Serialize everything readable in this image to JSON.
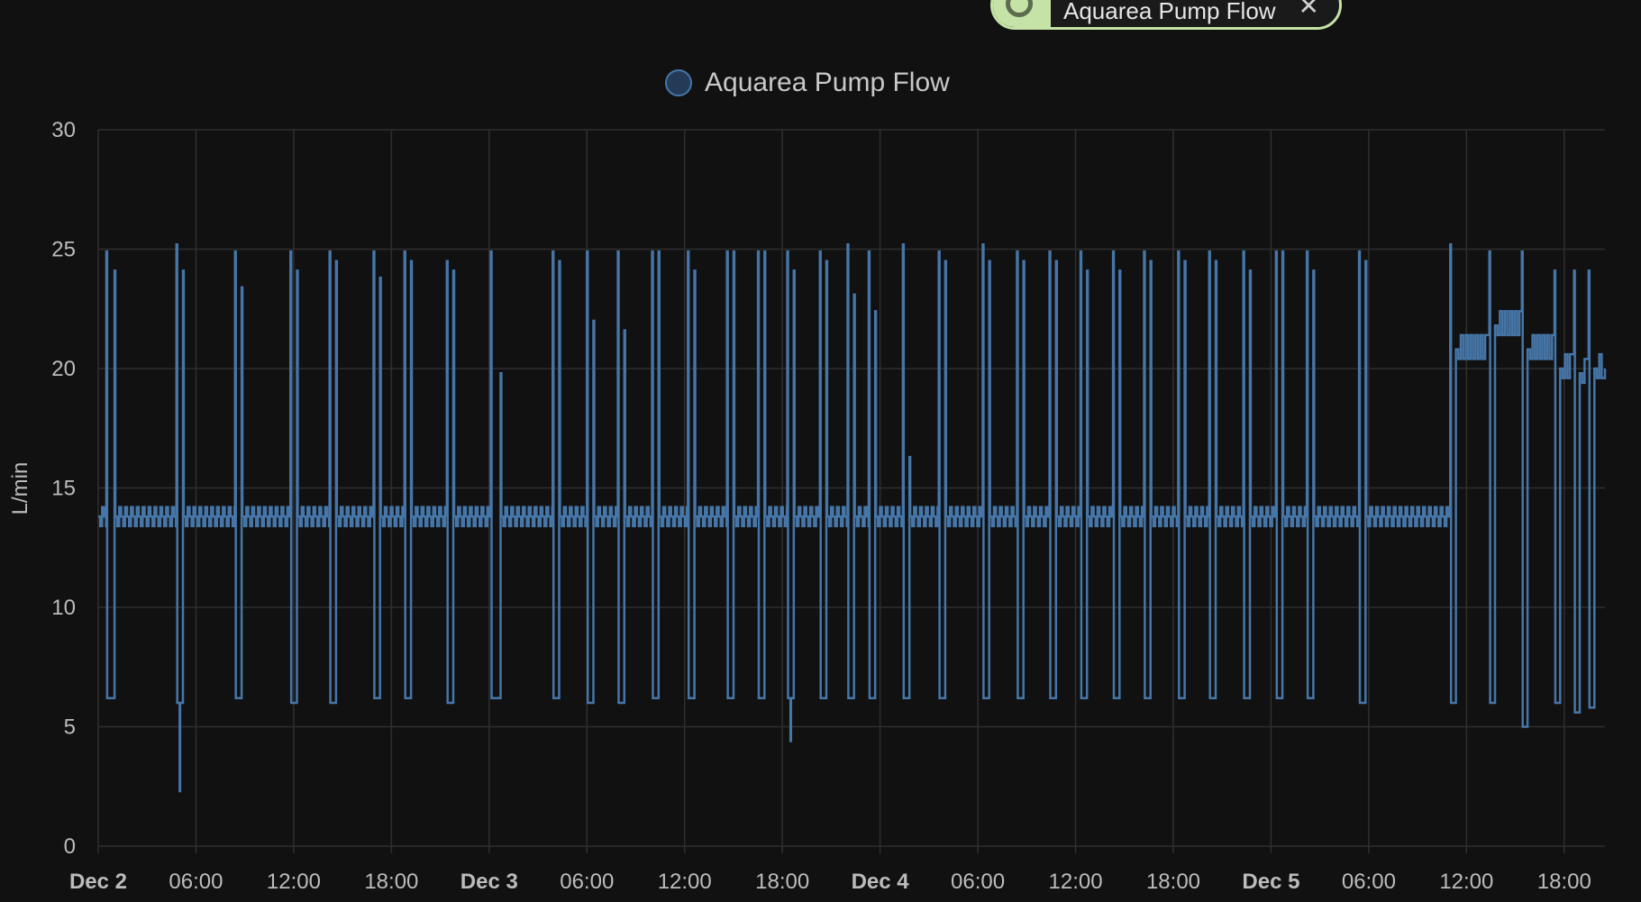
{
  "chip": {
    "label": "Aquarea Pump Flow",
    "close_glyph": "✕",
    "icon": "sensor-icon",
    "accent": "#c5e3a6"
  },
  "legend": {
    "label": "Aquarea Pump Flow",
    "color": "#4676a8"
  },
  "colors": {
    "background": "#111111",
    "grid": "#2f2f2f",
    "series": "#4676a8"
  },
  "chart_data": {
    "type": "line",
    "ylabel": "L/min",
    "ylim": [
      0,
      30
    ],
    "y_ticks": [
      0,
      5,
      10,
      15,
      20,
      25,
      30
    ],
    "x_range_hours": [
      0,
      92.5
    ],
    "x_ticks": [
      {
        "label": "Dec 2",
        "hour": 0,
        "major": true
      },
      {
        "label": "06:00",
        "hour": 6,
        "major": false
      },
      {
        "label": "12:00",
        "hour": 12,
        "major": false
      },
      {
        "label": "18:00",
        "hour": 18,
        "major": false
      },
      {
        "label": "Dec 3",
        "hour": 24,
        "major": true
      },
      {
        "label": "06:00",
        "hour": 30,
        "major": false
      },
      {
        "label": "12:00",
        "hour": 36,
        "major": false
      },
      {
        "label": "18:00",
        "hour": 42,
        "major": false
      },
      {
        "label": "Dec 4",
        "hour": 48,
        "major": true
      },
      {
        "label": "06:00",
        "hour": 54,
        "major": false
      },
      {
        "label": "12:00",
        "hour": 60,
        "major": false
      },
      {
        "label": "18:00",
        "hour": 66,
        "major": false
      },
      {
        "label": "Dec 5",
        "hour": 72,
        "major": true
      },
      {
        "label": "06:00",
        "hour": 78,
        "major": false
      },
      {
        "label": "12:00",
        "hour": 84,
        "major": false
      },
      {
        "label": "18:00",
        "hour": 90,
        "major": false
      }
    ],
    "series": [
      {
        "name": "Aquarea Pump Flow",
        "baseline": 13.8,
        "spikes": [
          [
            0.5,
            24.9,
            6.2,
            0.5,
            24.1
          ],
          [
            4.8,
            25.2,
            6.0,
            0.4,
            24.1,
            2.3
          ],
          [
            8.4,
            24.9,
            6.2,
            0.4,
            23.4
          ],
          [
            11.8,
            24.9,
            6.0,
            0.4,
            24.1
          ],
          [
            14.2,
            24.9,
            6.0,
            0.4,
            24.5
          ],
          [
            16.9,
            24.9,
            6.2,
            0.4,
            23.8
          ],
          [
            18.8,
            24.9,
            6.2,
            0.4,
            24.5
          ],
          [
            21.4,
            24.5,
            6.0,
            0.4,
            24.1
          ],
          [
            24.1,
            24.9,
            6.2,
            0.6,
            19.8
          ],
          [
            27.9,
            24.9,
            6.2,
            0.4,
            24.5
          ],
          [
            30.0,
            24.9,
            6.0,
            0.4,
            22.0
          ],
          [
            31.9,
            24.9,
            6.0,
            0.4,
            21.6
          ],
          [
            34.0,
            24.9,
            6.2,
            0.4,
            24.9
          ],
          [
            36.2,
            24.9,
            6.2,
            0.4,
            24.1
          ],
          [
            38.6,
            24.9,
            6.2,
            0.4,
            24.9
          ],
          [
            40.5,
            24.9,
            6.2,
            0.4,
            24.9
          ],
          [
            42.3,
            24.9,
            6.2,
            0.4,
            24.1,
            4.4
          ],
          [
            44.3,
            24.9,
            6.2,
            0.4,
            24.5
          ],
          [
            46.0,
            25.2,
            6.2,
            0.4,
            23.1
          ],
          [
            47.3,
            24.9,
            6.2,
            0.4,
            22.4
          ],
          [
            49.4,
            25.2,
            6.2,
            0.4,
            16.3
          ],
          [
            51.6,
            24.9,
            6.2,
            0.4,
            24.5
          ],
          [
            54.3,
            25.2,
            6.2,
            0.4,
            24.5
          ],
          [
            56.4,
            24.9,
            6.2,
            0.4,
            24.5
          ],
          [
            58.4,
            24.9,
            6.2,
            0.4,
            24.5
          ],
          [
            60.3,
            24.9,
            6.2,
            0.4,
            24.1
          ],
          [
            62.3,
            24.9,
            6.2,
            0.4,
            24.1
          ],
          [
            64.2,
            24.9,
            6.2,
            0.4,
            24.5
          ],
          [
            66.3,
            24.9,
            6.2,
            0.4,
            24.5
          ],
          [
            68.2,
            24.9,
            6.2,
            0.4,
            24.5
          ],
          [
            70.3,
            24.9,
            6.2,
            0.4,
            24.1
          ],
          [
            72.3,
            24.9,
            6.2,
            0.4,
            24.9
          ],
          [
            74.2,
            24.9,
            6.2,
            0.4,
            24.1
          ],
          [
            77.4,
            24.9,
            6.0,
            0.4,
            24.5
          ]
        ],
        "late_segment": {
          "start": 83.0,
          "levels": [
            [
              83.0,
              25.2,
              6.0,
              20.8
            ],
            [
              85.4,
              24.9,
              6.0,
              21.8
            ],
            [
              87.4,
              24.9,
              5.0,
              20.8
            ],
            [
              89.4,
              24.1,
              6.0,
              20.0
            ],
            [
              90.6,
              24.1,
              5.6,
              19.8
            ],
            [
              91.5,
              24.1,
              5.8,
              20.0
            ]
          ]
        }
      }
    ]
  }
}
